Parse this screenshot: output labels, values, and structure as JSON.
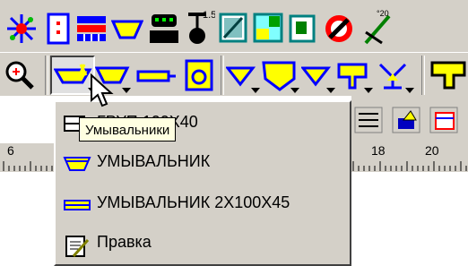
{
  "toolbar_top": {
    "icons": [
      "sparkle-icon",
      "door-icon",
      "radiator-icon",
      "sink-icon",
      "toilet-icon",
      "shower-icon",
      "bathtub-icon",
      "floor-plan-icon",
      "plan-icon",
      "no-entry-icon",
      "pipe-tool-icon"
    ],
    "shower_text": "1.5"
  },
  "toolbar_second": {
    "icons": [
      "zoom-icon",
      "washbasin-tool-icon",
      "sink-small-icon",
      "pipe-line-icon",
      "drain-box-icon",
      "funnel-icon",
      "drain-trap-icon",
      "filter-icon",
      "shield-drain-icon",
      "valve-icon",
      "fixture-icon"
    ]
  },
  "menu": {
    "items": [
      {
        "label": "ГРУП 100Х40",
        "icon": "washbasin-group-icon"
      },
      {
        "label": "УМЫВАЛЬНИК",
        "icon": "washbasin-icon"
      },
      {
        "label": "УМЫВАЛЬНИК 2Х100Х45",
        "icon": "double-washbasin-icon"
      },
      {
        "label": "Правка",
        "icon": "edit-icon"
      }
    ]
  },
  "tooltip": {
    "text": "Умывальники"
  },
  "ruler": {
    "labels": [
      "6",
      "18",
      "20"
    ]
  },
  "colors": {
    "toolbar_bg": "#d4d0c8",
    "icon_yellow": "#ffff00",
    "icon_teal": "#008080",
    "tooltip_bg": "#ffffe1"
  }
}
